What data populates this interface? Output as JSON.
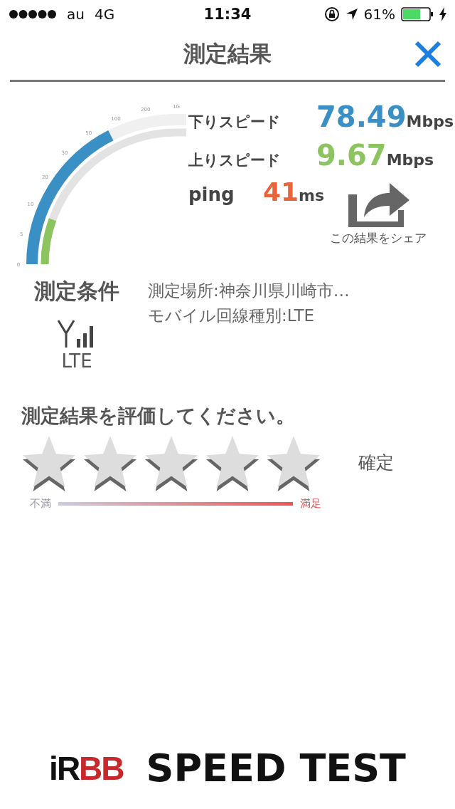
{
  "status_bar": {
    "carrier": "au",
    "network": "4G",
    "time": "11:34",
    "battery": "61%"
  },
  "header": {
    "title": "測定結果"
  },
  "gauge": {
    "ticks": [
      "0",
      "5",
      "10",
      "20",
      "30",
      "50",
      "100",
      "200",
      "1G"
    ]
  },
  "results": {
    "download": {
      "label": "下りスピード",
      "value": "78.49",
      "unit": "Mbps"
    },
    "upload": {
      "label": "上りスピード",
      "value": "9.67",
      "unit": "Mbps"
    },
    "ping": {
      "label": "ping",
      "value": "41",
      "unit": "ms"
    },
    "share": {
      "label": "この結果をシェア"
    }
  },
  "conditions": {
    "title": "測定条件",
    "network_type": "LTE",
    "lines": [
      "測定場所:神奈川県川崎市…",
      "モバイル回線種別:LTE"
    ]
  },
  "rating": {
    "title": "測定結果を評価してください。",
    "stars": 0,
    "confirm": "確定",
    "low_label": "不満",
    "high_label": "満足"
  },
  "footer": {
    "logo_prefix": "iR",
    "logo_bb": "BB",
    "product": "SPEED TEST"
  }
}
